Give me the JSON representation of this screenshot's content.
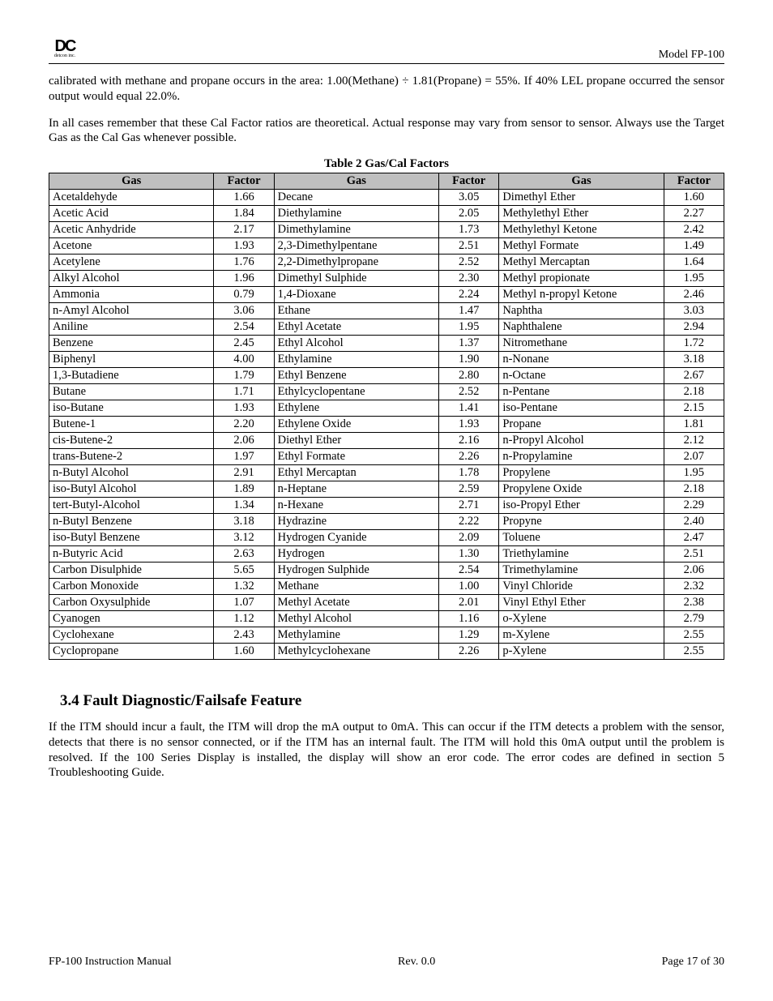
{
  "header": {
    "logo_text": "DC",
    "logo_sub": "detcon inc.",
    "model": "Model FP-100"
  },
  "paragraphs": {
    "p1": "calibrated with methane and propane occurs in the area: 1.00(Methane) ÷ 1.81(Propane) = 55%. If 40% LEL propane occurred the sensor output would equal 22.0%.",
    "p2": "In all cases remember that these Cal Factor ratios are theoretical.  Actual response may vary from sensor to sensor.  Always use the Target Gas as the Cal Gas whenever possible."
  },
  "table": {
    "caption": "Table 2 Gas/Cal Factors",
    "headers": [
      "Gas",
      "Factor",
      "Gas",
      "Factor",
      "Gas",
      "Factor"
    ],
    "rows": [
      [
        "Acetaldehyde",
        "1.66",
        "Decane",
        "3.05",
        "Dimethyl Ether",
        "1.60"
      ],
      [
        "Acetic Acid",
        "1.84",
        "Diethylamine",
        "2.05",
        "Methylethyl Ether",
        "2.27"
      ],
      [
        "Acetic Anhydride",
        "2.17",
        "Dimethylamine",
        "1.73",
        "Methylethyl Ketone",
        "2.42"
      ],
      [
        "Acetone",
        "1.93",
        "2,3-Dimethylpentane",
        "2.51",
        "Methyl Formate",
        "1.49"
      ],
      [
        "Acetylene",
        "1.76",
        "2,2-Dimethylpropane",
        "2.52",
        "Methyl Mercaptan",
        "1.64"
      ],
      [
        "Alkyl Alcohol",
        "1.96",
        "Dimethyl Sulphide",
        "2.30",
        "Methyl propionate",
        "1.95"
      ],
      [
        "Ammonia",
        "0.79",
        "1,4-Dioxane",
        "2.24",
        "Methyl n-propyl Ketone",
        "2.46"
      ],
      [
        "n-Amyl Alcohol",
        "3.06",
        "Ethane",
        "1.47",
        "Naphtha",
        "3.03"
      ],
      [
        "Aniline",
        "2.54",
        "Ethyl Acetate",
        "1.95",
        "Naphthalene",
        "2.94"
      ],
      [
        "Benzene",
        "2.45",
        "Ethyl Alcohol",
        "1.37",
        "Nitromethane",
        "1.72"
      ],
      [
        "Biphenyl",
        "4.00",
        "Ethylamine",
        "1.90",
        "n-Nonane",
        "3.18"
      ],
      [
        "1,3-Butadiene",
        "1.79",
        "Ethyl Benzene",
        "2.80",
        "n-Octane",
        "2.67"
      ],
      [
        "Butane",
        "1.71",
        "Ethylcyclopentane",
        "2.52",
        "n-Pentane",
        "2.18"
      ],
      [
        "iso-Butane",
        "1.93",
        "Ethylene",
        "1.41",
        "iso-Pentane",
        "2.15"
      ],
      [
        "Butene-1",
        "2.20",
        "Ethylene Oxide",
        "1.93",
        "Propane",
        "1.81"
      ],
      [
        "cis-Butene-2",
        "2.06",
        "Diethyl Ether",
        "2.16",
        "n-Propyl Alcohol",
        "2.12"
      ],
      [
        "trans-Butene-2",
        "1.97",
        "Ethyl Formate",
        "2.26",
        "n-Propylamine",
        "2.07"
      ],
      [
        "n-Butyl Alcohol",
        "2.91",
        "Ethyl Mercaptan",
        "1.78",
        "Propylene",
        "1.95"
      ],
      [
        "iso-Butyl Alcohol",
        "1.89",
        "n-Heptane",
        "2.59",
        "Propylene Oxide",
        "2.18"
      ],
      [
        "tert-Butyl-Alcohol",
        "1.34",
        "n-Hexane",
        "2.71",
        "iso-Propyl Ether",
        "2.29"
      ],
      [
        "n-Butyl Benzene",
        "3.18",
        "Hydrazine",
        "2.22",
        "Propyne",
        "2.40"
      ],
      [
        "iso-Butyl Benzene",
        "3.12",
        "Hydrogen Cyanide",
        "2.09",
        "Toluene",
        "2.47"
      ],
      [
        "n-Butyric Acid",
        "2.63",
        "Hydrogen",
        "1.30",
        "Triethylamine",
        "2.51"
      ],
      [
        "Carbon Disulphide",
        "5.65",
        "Hydrogen Sulphide",
        "2.54",
        "Trimethylamine",
        "2.06"
      ],
      [
        "Carbon Monoxide",
        "1.32",
        "Methane",
        "1.00",
        "Vinyl Chloride",
        "2.32"
      ],
      [
        "Carbon Oxysulphide",
        "1.07",
        "Methyl Acetate",
        "2.01",
        "Vinyl Ethyl Ether",
        "2.38"
      ],
      [
        "Cyanogen",
        "1.12",
        "Methyl Alcohol",
        "1.16",
        "o-Xylene",
        "2.79"
      ],
      [
        "Cyclohexane",
        "2.43",
        "Methylamine",
        "1.29",
        "m-Xylene",
        "2.55"
      ],
      [
        "Cyclopropane",
        "1.60",
        "Methylcyclohexane",
        "2.26",
        "p-Xylene",
        "2.55"
      ]
    ]
  },
  "section": {
    "heading": "3.4   Fault Diagnostic/Failsafe Feature",
    "body": "If the ITM should incur a fault, the ITM will drop the mA output to 0mA.  This can occur if the ITM detects a problem with the sensor, detects that there is no sensor connected, or if the ITM has an internal fault.  The ITM will hold this 0mA output until the problem is resolved.  If the 100 Series Display is installed, the display will show an eror code.  The error codes are defined in section 5 Troubleshooting Guide."
  },
  "footer": {
    "left": "FP-100 Instruction Manual",
    "center": "Rev. 0.0",
    "right": "Page 17 of 30"
  }
}
